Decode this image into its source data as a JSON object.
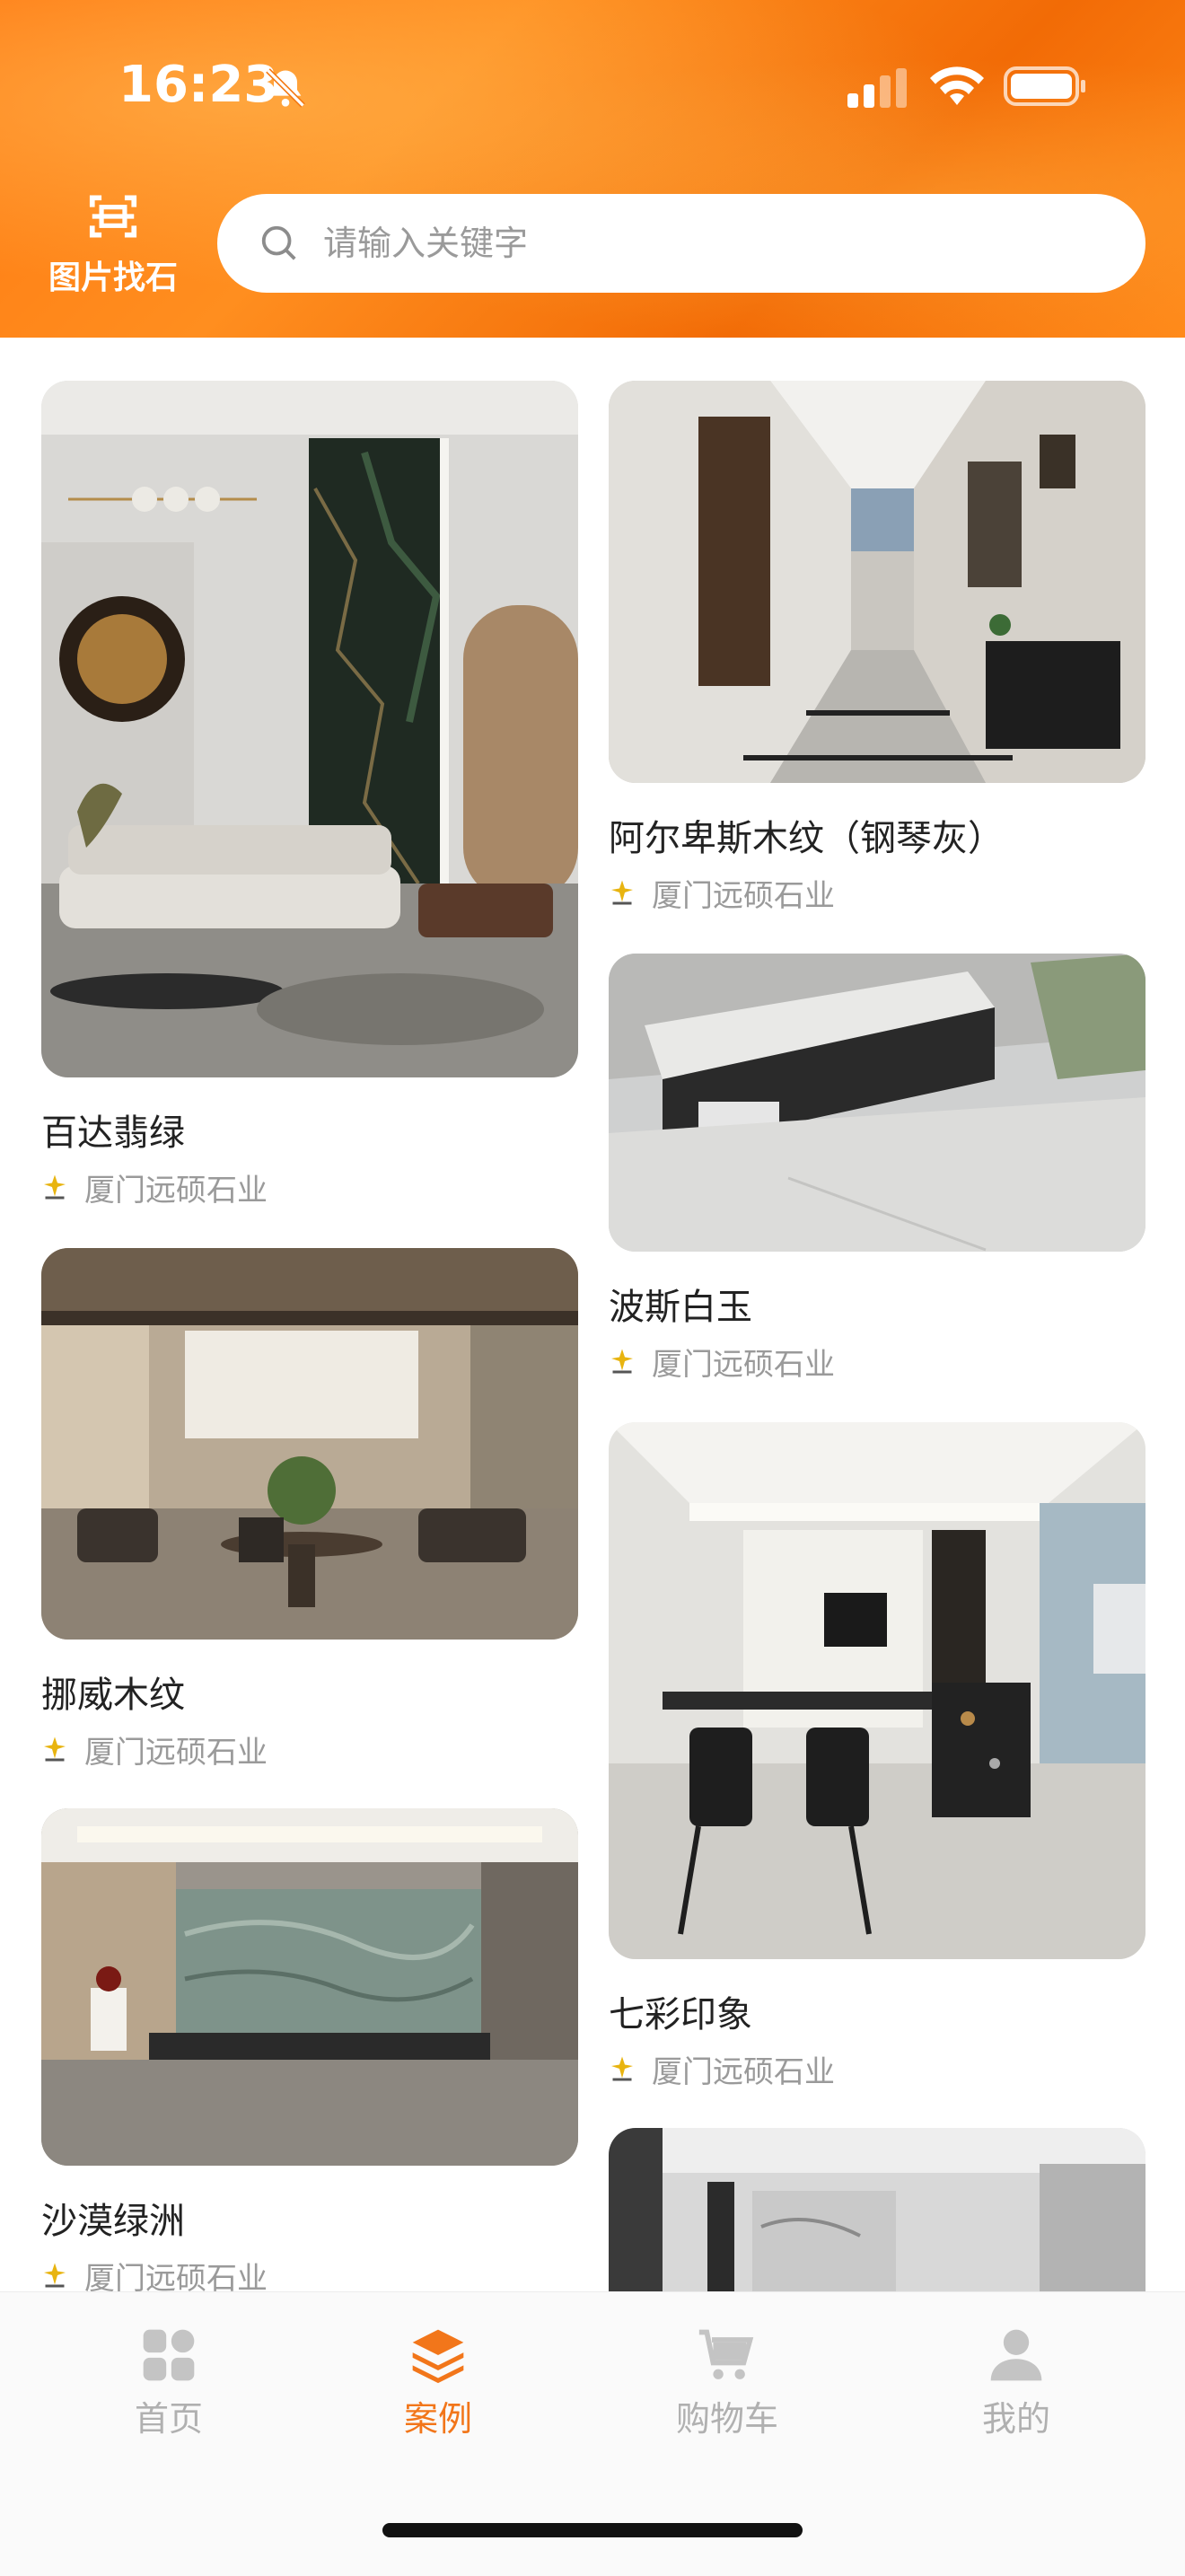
{
  "status_bar": {
    "time": "16:23"
  },
  "header": {
    "scan_label": "图片找石",
    "search_placeholder": "请输入关键字"
  },
  "cards": [
    {
      "title": "百达翡绿",
      "vendor": "厦门远硕石业"
    },
    {
      "title": "阿尔卑斯木纹（钢琴灰）",
      "vendor": "厦门远硕石业"
    },
    {
      "title": "波斯白玉",
      "vendor": "厦门远硕石业"
    },
    {
      "title": "挪威木纹",
      "vendor": "厦门远硕石业"
    },
    {
      "title": "七彩印象",
      "vendor": "厦门远硕石业"
    },
    {
      "title": "沙漠绿洲",
      "vendor": "厦门远硕石业"
    }
  ],
  "tabbar": {
    "tabs": [
      {
        "label": "首页",
        "active": false
      },
      {
        "label": "案例",
        "active": true
      },
      {
        "label": "购物车",
        "active": false
      },
      {
        "label": "我的",
        "active": false
      }
    ]
  },
  "colors": {
    "accent": "#f2761a",
    "header_orange": "#ff7a12",
    "inactive": "#b0b0b0"
  },
  "icons": [
    "bell-mute-icon",
    "signal-icon",
    "wifi-icon",
    "battery-icon",
    "scan-icon",
    "search-icon",
    "vendor-logo-icon",
    "home-icon",
    "cases-icon",
    "cart-icon",
    "user-icon"
  ]
}
